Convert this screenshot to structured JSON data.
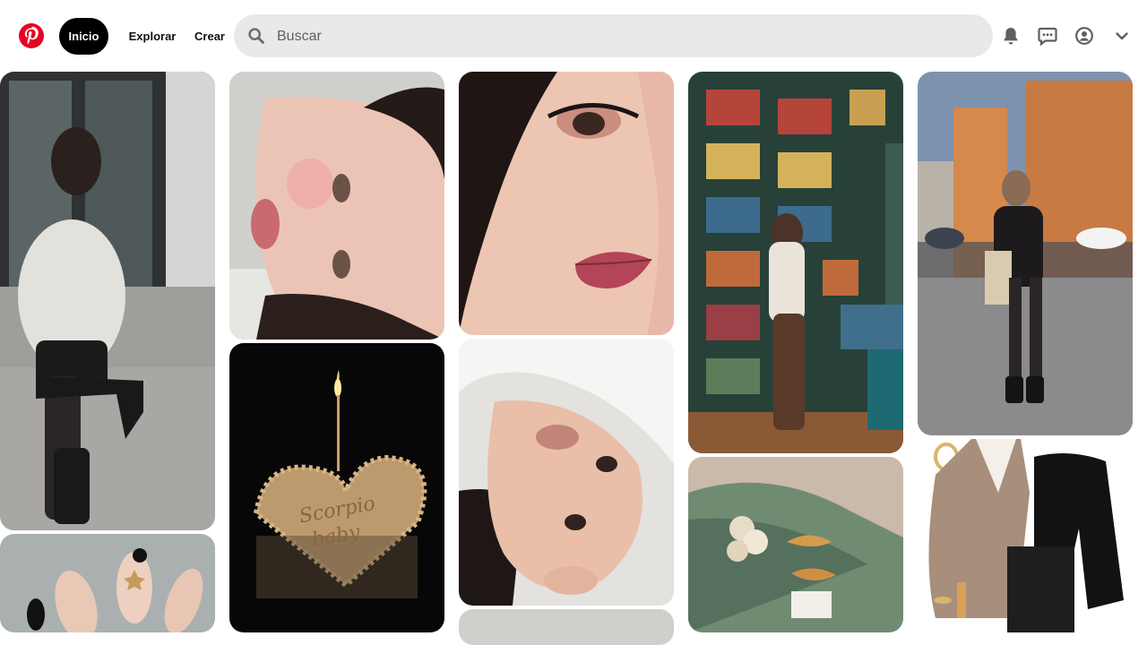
{
  "header": {
    "logo_icon": "pinterest-logo",
    "nav": {
      "home": "Inicio",
      "explore": "Explorar",
      "create": "Crear"
    },
    "search": {
      "placeholder": "Buscar",
      "icon": "search-icon"
    },
    "icons": [
      "bell-icon",
      "message-icon",
      "profile-icon",
      "chevron-down-icon"
    ]
  },
  "colors": {
    "brand_red": "#e60023",
    "active_nav_bg": "#000000",
    "search_bg": "#e9e9e9"
  },
  "pins": [
    {
      "column": 1,
      "subject": "girl-in-sweater-and-boots"
    },
    {
      "column": 1,
      "subject": "manicure-nails"
    },
    {
      "column": 2,
      "subject": "face-selfie"
    },
    {
      "column": 2,
      "subject": "heart-cake-with-candle",
      "cake_text": "Scorpio baby"
    },
    {
      "column": 3,
      "subject": "close-up-makeup"
    },
    {
      "column": 3,
      "subject": "lying-selfie"
    },
    {
      "column": 4,
      "subject": "girl-at-bookshelf"
    },
    {
      "column": 4,
      "subject": "green-car-with-flowers-and-croissants"
    },
    {
      "column": 5,
      "subject": "girl-on-city-street"
    },
    {
      "column": 5,
      "subject": "outfit-flatlay"
    }
  ]
}
